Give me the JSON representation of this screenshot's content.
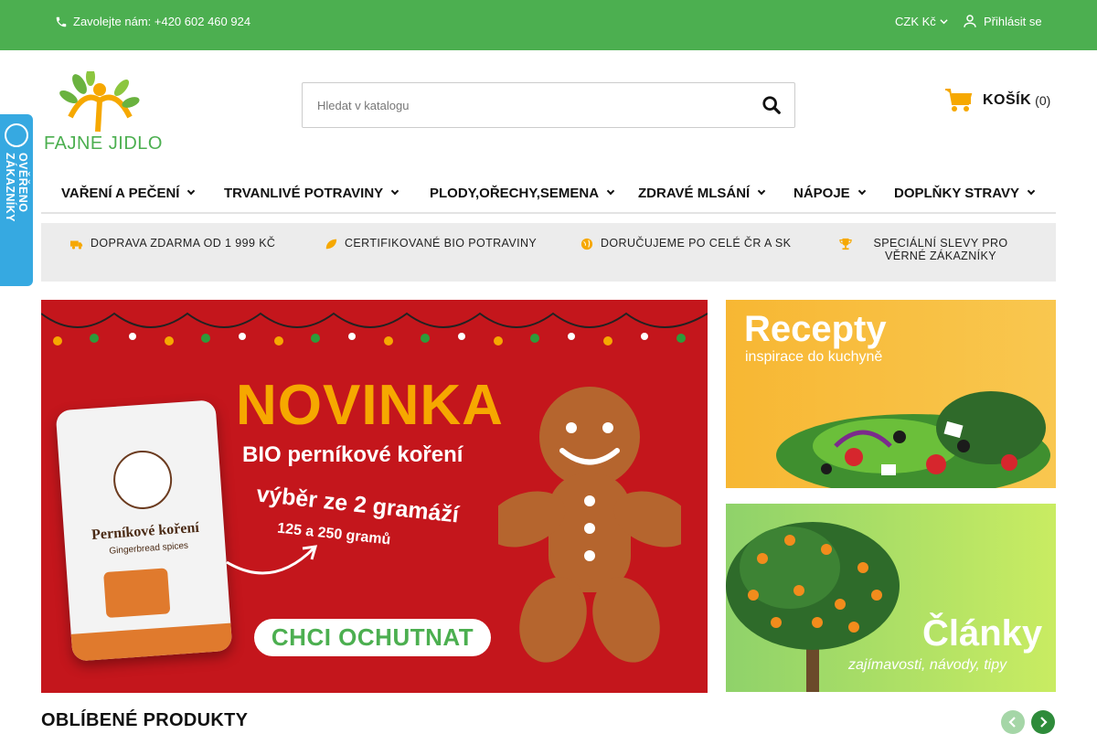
{
  "topbar": {
    "phone_text": "Zavolejte nám: +420 602 460 924",
    "currency": "CZK Kč",
    "login": "Přihlásit se"
  },
  "header": {
    "logo_text": "FAJNE JIDLO",
    "search_placeholder": "Hledat v katalogu",
    "cart_label": "KOŠÍK",
    "cart_count": "(0)"
  },
  "nav": {
    "items": [
      {
        "label": "VAŘENÍ A PEČENÍ"
      },
      {
        "label": "TRVANLIVÉ POTRAVINY"
      },
      {
        "label": "PLODY,OŘECHY,SEMENA"
      },
      {
        "label": "ZDRAVÉ MLSÁNÍ"
      },
      {
        "label": "NÁPOJE"
      },
      {
        "label": "DOPLŇKY STRAVY"
      }
    ]
  },
  "benefits": [
    {
      "icon": "truck-icon",
      "text": "DOPRAVA ZDARMA OD 1 999 KČ"
    },
    {
      "icon": "leaf-icon",
      "text": "CERTIFIKOVANÉ BIO POTRAVINY"
    },
    {
      "icon": "globe-icon",
      "text": "DORUČUJEME PO CELÉ ČR A SK"
    },
    {
      "icon": "trophy-icon",
      "text": "SPECIÁLNÍ SLEVY PRO VĚRNÉ ZÁKAZNÍKY"
    }
  ],
  "verified_badge": "OVĚŘENO ZÁKAZNÍKY",
  "banners": {
    "main": {
      "title": "NOVINKA",
      "subtitle": "BIO perníkové koření",
      "choice": "výběr ze 2 gramáží",
      "grams": "125 a 250 gramů",
      "cta": "CHCI OCHUTNAT"
    },
    "recipes": {
      "title": "Recepty",
      "subtitle": "inspirace do kuchyně"
    },
    "articles": {
      "title": "Články",
      "subtitle": "zajímavosti, návody, tipy"
    }
  },
  "products": {
    "heading": "OBLÍBENÉ PRODUKTY"
  },
  "colors": {
    "brand_green": "#4caf50",
    "banner_red": "#c4161c",
    "accent_orange": "#f6a800",
    "verified_blue": "#36a9e1"
  }
}
